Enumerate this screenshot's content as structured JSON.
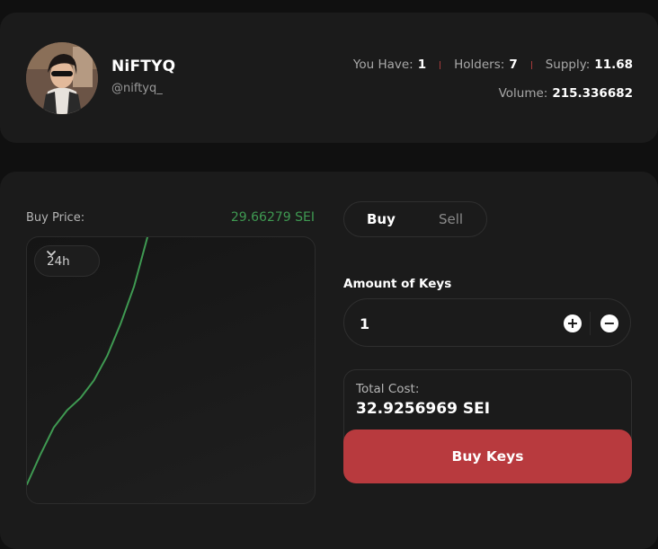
{
  "profile": {
    "name": "NiFTYQ",
    "handle": "@niftyq_",
    "stats": {
      "you_have_label": "You Have:",
      "you_have_value": "1",
      "holders_label": "Holders:",
      "holders_value": "7",
      "supply_label": "Supply:",
      "supply_value": "11.68",
      "volume_label": "Volume:",
      "volume_value": "215.336682"
    }
  },
  "price": {
    "label": "Buy Price:",
    "value": "29.66279 SEI"
  },
  "chart": {
    "range_selected": "24h",
    "line_color": "#3f9a52"
  },
  "chart_data": {
    "type": "line",
    "series": [
      {
        "values": [
          0,
          0.12,
          0.23,
          0.3,
          0.35,
          0.42,
          0.52,
          0.65,
          0.8,
          1.0
        ]
      }
    ]
  },
  "trade": {
    "tabs": [
      "Buy",
      "Sell"
    ],
    "active_tab": "Buy",
    "amount_label": "Amount of Keys",
    "amount_value": "1",
    "plus_symbol": "+",
    "minus_symbol": "−",
    "total_cost_label": "Total Cost:",
    "total_cost_value": "32.9256969 SEI",
    "buy_button_label": "Buy Keys"
  },
  "colors": {
    "accent_red": "#b83a3e",
    "price_green": "#3f9a52"
  }
}
